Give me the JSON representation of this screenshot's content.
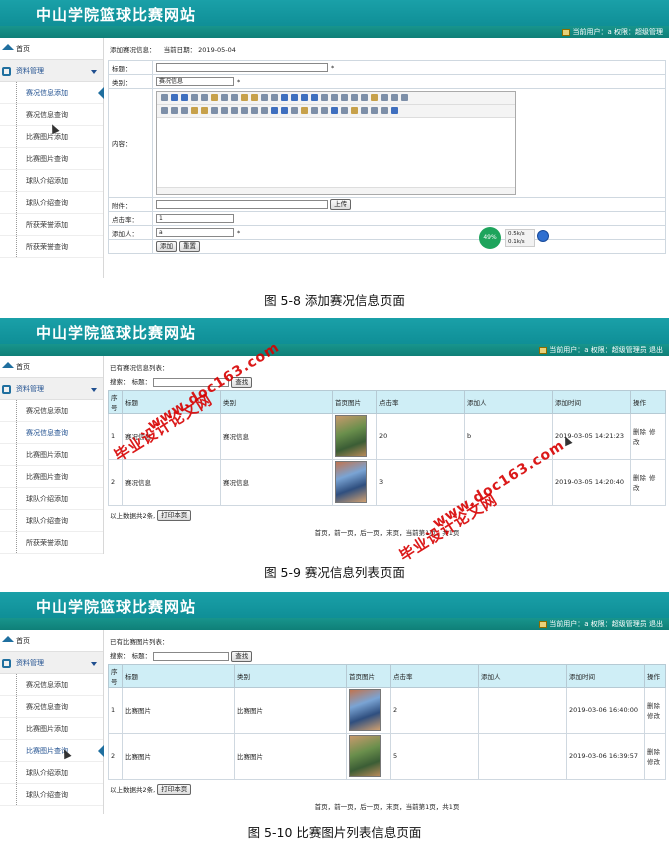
{
  "common": {
    "site_title": "中山学院篮球比赛网站",
    "topbar_short": "当前用户：a 权限：超级管理",
    "topbar_long": "当前用户：a 权限：超级管理员 退出",
    "home": "首页",
    "group": "资料管理"
  },
  "shot1": {
    "sidebar": [
      "赛况信息添加",
      "赛况信息查询",
      "比赛图片添加",
      "比赛图片查询",
      "球队介绍添加",
      "球队介绍查询",
      "所获荣誉添加",
      "所获荣誉查询"
    ],
    "header_prefix": "添加赛况信息：",
    "date_label": "当前日期：",
    "date_value": "2019-05-04",
    "fields": {
      "title_label": "标题：",
      "type_label": "类别：",
      "type_value": "赛况信息",
      "content_label": "内容：",
      "attach_label": "附件：",
      "upload_btn": "上传",
      "clicks_label": "点击率：",
      "clicks_value": "1",
      "adder_label": "添加人：",
      "adder_value": "a",
      "star": "*"
    },
    "submit_btn": "添加",
    "reset_btn": "重置",
    "status": {
      "pct": "49%",
      "up": "0.5k/s",
      "down": "0.1k/s"
    },
    "caption": "图 5-8 添加赛况信息页面"
  },
  "shot2": {
    "sidebar": [
      "赛况信息添加",
      "赛况信息查询",
      "比赛图片添加",
      "比赛图片查询",
      "球队介绍添加",
      "球队介绍查询",
      "所获荣誉添加"
    ],
    "list_title": "已有赛况信息列表：",
    "search_label": "搜索：",
    "search_field_label": "标题：",
    "search_btn": "查找",
    "columns": [
      "序号",
      "标题",
      "类别",
      "首页图片",
      "点击率",
      "添加人",
      "添加时间",
      "操作"
    ],
    "rows": [
      [
        "1",
        "赛况信息",
        "赛况信息",
        "",
        "20",
        "b",
        "2019-03-05 14:21:23"
      ],
      [
        "2",
        "赛况信息",
        "赛况信息",
        "",
        "3",
        "",
        "2019-03-05 14:20:40"
      ]
    ],
    "op_delete": "删除",
    "op_edit": "修改",
    "summary": "以上数据共2条,",
    "print_btn": "打印本页",
    "pager": "首页，前一页，后一页，末页，当前第1页，共1页",
    "caption": "图 5-9 赛况信息列表页面"
  },
  "shot3": {
    "sidebar": [
      "赛况信息添加",
      "赛况信息查询",
      "比赛图片添加",
      "比赛图片查询",
      "球队介绍添加",
      "球队介绍查询"
    ],
    "list_title": "已有比赛图片列表：",
    "search_label": "搜索：",
    "search_field_label": "标题：",
    "search_btn": "查找",
    "columns": [
      "序号",
      "标题",
      "类别",
      "首页图片",
      "点击率",
      "添加人",
      "添加时间",
      "操作"
    ],
    "rows": [
      [
        "1",
        "比赛图片",
        "比赛图片",
        "",
        "2",
        "",
        "2019-03-06 16:40:00"
      ],
      [
        "2",
        "比赛图片",
        "比赛图片",
        "",
        "5",
        "",
        "2019-03-06 16:39:57"
      ]
    ],
    "op_delete": "删除",
    "op_edit": "修改",
    "summary": "以上数据共2条,",
    "print_btn": "打印本页",
    "pager": "首页，前一页，后一页，末页，当前第1页，共1页",
    "caption": "图 5-10 比赛图片列表信息页面"
  },
  "watermark": {
    "text_cn": "毕业设计论文网",
    "text_url": "www.doc163.com"
  },
  "colors": {
    "banner": "#1aa0a8",
    "topbar": "#0f7f78",
    "table_head": "#cfeef6",
    "watermark": "#d70000"
  }
}
